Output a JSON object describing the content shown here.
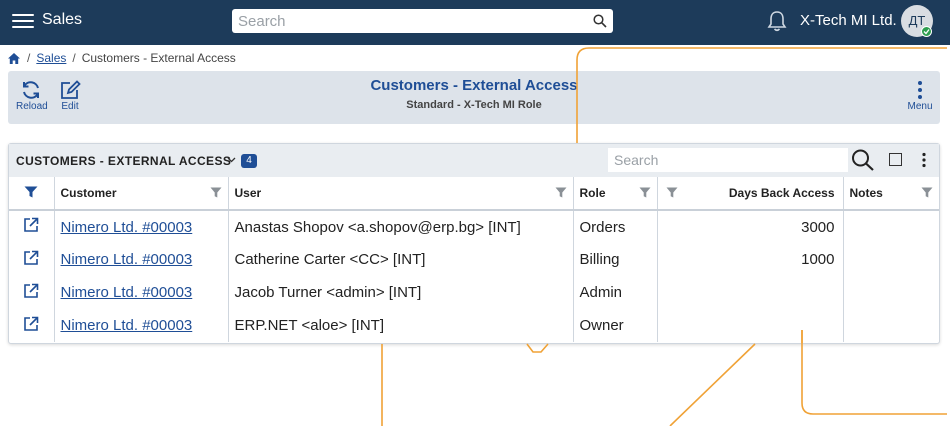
{
  "app": {
    "title": "Sales",
    "search_placeholder": "Search",
    "company": "X-Tech MI Ltd.",
    "avatar_initials": "ДТ"
  },
  "breadcrumb": {
    "items": [
      "Sales",
      "Customers - External Access"
    ]
  },
  "commands": {
    "reload_label": "Reload",
    "edit_label": "Edit",
    "menu_label": "Menu"
  },
  "page": {
    "title": "Customers - External Access",
    "subtitle": "Standard - X-Tech MI Role"
  },
  "panel": {
    "title": "CUSTOMERS - EXTERNAL ACCESS",
    "count": "4",
    "search_placeholder": "Search"
  },
  "table": {
    "columns": [
      "Customer",
      "User",
      "Role",
      "Days Back Access",
      "Notes"
    ],
    "rows": [
      {
        "customer": "Nimero Ltd. #00003",
        "user": "Anastas Shopov <a.shopov@erp.bg> [INT]",
        "role": "Orders",
        "days": "3000",
        "notes": ""
      },
      {
        "customer": "Nimero Ltd. #00003",
        "user": "Catherine Carter <CC> [INT]",
        "role": "Billing",
        "days": "1000",
        "notes": ""
      },
      {
        "customer": "Nimero Ltd. #00003",
        "user": "Jacob Turner <admin> [INT]",
        "role": "Admin",
        "days": "",
        "notes": ""
      },
      {
        "customer": "Nimero Ltd. #00003",
        "user": "ERP.NET <aloe> [INT]",
        "role": "Owner",
        "days": "",
        "notes": ""
      }
    ]
  },
  "colors": {
    "topbar": "#1d3b5a",
    "accent": "#1f4e96",
    "overlay_line": "#f0a236",
    "status_online": "#2e9e4f"
  },
  "icons": [
    "menu-icon",
    "search-icon",
    "bell-icon",
    "home-icon",
    "reload-icon",
    "edit-icon",
    "kebab-icon",
    "chevron-down-icon",
    "filter-icon",
    "open-external-icon",
    "select-all-icon"
  ]
}
